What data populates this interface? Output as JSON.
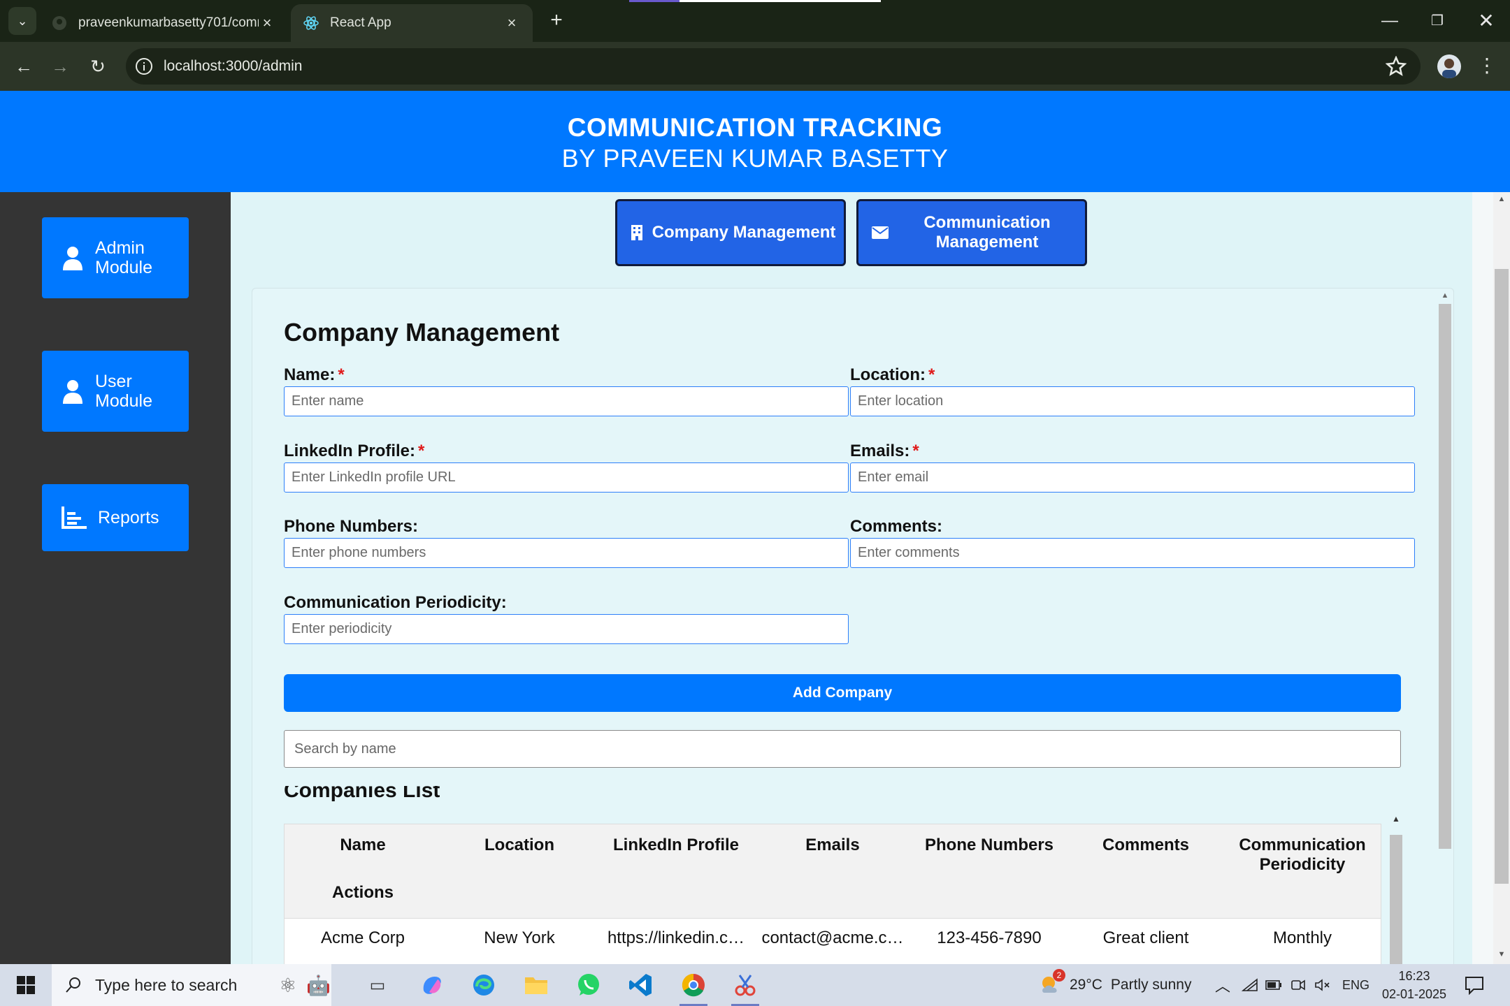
{
  "browser": {
    "tabs": [
      {
        "title": "praveenkumarbasetty701/comm",
        "active": false
      },
      {
        "title": "React App",
        "active": true
      }
    ],
    "url": "localhost:3000/admin"
  },
  "header": {
    "title": "COMMUNICATION TRACKING",
    "subtitle": "BY PRAVEEN KUMAR BASETTY"
  },
  "sidebar": {
    "items": [
      {
        "label": "Admin Module",
        "icon": "user-icon"
      },
      {
        "label": "User Module",
        "icon": "user-icon"
      },
      {
        "label": "Reports",
        "icon": "bar-chart-icon"
      }
    ]
  },
  "top_buttons": {
    "company": "Company Management",
    "communication": "Communication Management"
  },
  "form": {
    "title": "Company Management",
    "required_mark": "*",
    "fields": {
      "name": {
        "label": "Name:",
        "placeholder": "Enter name",
        "required": true
      },
      "location": {
        "label": "Location:",
        "placeholder": "Enter location",
        "required": true
      },
      "linkedin": {
        "label": "LinkedIn Profile:",
        "placeholder": "Enter LinkedIn profile URL",
        "required": true
      },
      "emails": {
        "label": "Emails:",
        "placeholder": "Enter email",
        "required": true
      },
      "phones": {
        "label": "Phone Numbers:",
        "placeholder": "Enter phone numbers",
        "required": false
      },
      "comments": {
        "label": "Comments:",
        "placeholder": "Enter comments",
        "required": false
      },
      "periodicity": {
        "label": "Communication Periodicity:",
        "placeholder": "Enter periodicity",
        "required": false
      }
    },
    "submit_label": "Add Company",
    "search_placeholder": "Search by name"
  },
  "companies": {
    "title": "Companies List",
    "columns": [
      "Name",
      "Location",
      "LinkedIn Profile",
      "Emails",
      "Phone Numbers",
      "Comments",
      "Communication Periodicity",
      "Actions"
    ],
    "rows": [
      [
        "Acme Corp",
        "New York",
        "https://linkedin.c…",
        "contact@acme.c…",
        "123-456-7890",
        "Great client",
        "Monthly"
      ]
    ]
  },
  "taskbar": {
    "search_placeholder": "Type here to search",
    "weather_temp": "29°C",
    "weather_text": "Partly sunny",
    "weather_badge": "2",
    "language": "ENG",
    "time": "16:23",
    "date": "02-01-2025"
  },
  "colors": {
    "brand_blue": "#0078ff",
    "top_button_blue": "#2264e6",
    "sidebar_bg": "#343434",
    "main_bg": "#dff4f7"
  }
}
